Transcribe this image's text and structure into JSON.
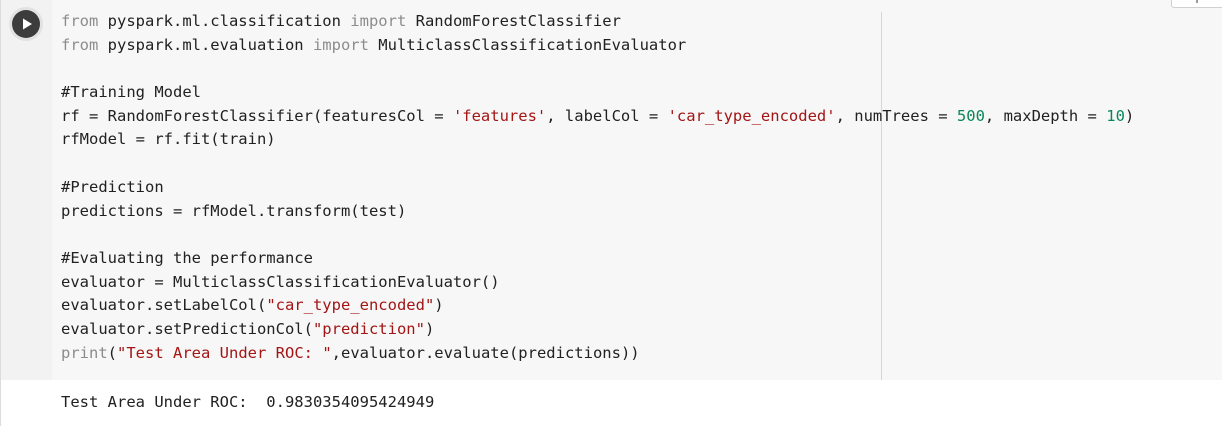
{
  "cell": {
    "run_button_icon": "play-icon",
    "code_lines": [
      [
        {
          "t": "from",
          "c": "kw"
        },
        {
          "t": " pyspark.ml.classification ",
          "c": ""
        },
        {
          "t": "import",
          "c": "kw"
        },
        {
          "t": " RandomForestClassifier",
          "c": ""
        }
      ],
      [
        {
          "t": "from",
          "c": "kw"
        },
        {
          "t": " pyspark.ml.evaluation ",
          "c": ""
        },
        {
          "t": "import",
          "c": "kw"
        },
        {
          "t": " MulticlassClassificationEvaluator",
          "c": ""
        }
      ],
      [],
      [
        {
          "t": "#Training Model",
          "c": ""
        }
      ],
      [
        {
          "t": "rf = RandomForestClassifier(featuresCol = ",
          "c": ""
        },
        {
          "t": "'features'",
          "c": "str"
        },
        {
          "t": ", labelCol = ",
          "c": ""
        },
        {
          "t": "'car_type_encoded'",
          "c": "str"
        },
        {
          "t": ", numTrees = ",
          "c": ""
        },
        {
          "t": "500",
          "c": "num"
        },
        {
          "t": ", maxDepth = ",
          "c": ""
        },
        {
          "t": "10",
          "c": "num"
        },
        {
          "t": ")",
          "c": ""
        }
      ],
      [
        {
          "t": "rfModel = rf.fit(train)",
          "c": ""
        }
      ],
      [],
      [
        {
          "t": "#Prediction",
          "c": ""
        }
      ],
      [
        {
          "t": "predictions = rfModel.transform(test)",
          "c": ""
        }
      ],
      [],
      [
        {
          "t": "#Evaluating the performance",
          "c": ""
        }
      ],
      [
        {
          "t": "evaluator = MulticlassClassificationEvaluator()",
          "c": ""
        }
      ],
      [
        {
          "t": "evaluator.setLabelCol(",
          "c": ""
        },
        {
          "t": "\"car_type_encoded\"",
          "c": "str"
        },
        {
          "t": ")",
          "c": ""
        }
      ],
      [
        {
          "t": "evaluator.setPredictionCol(",
          "c": ""
        },
        {
          "t": "\"prediction\"",
          "c": "str"
        },
        {
          "t": ")",
          "c": ""
        }
      ],
      [
        {
          "t": "print",
          "c": "kw"
        },
        {
          "t": "(",
          "c": ""
        },
        {
          "t": "\"Test Area Under ROC: \"",
          "c": "str"
        },
        {
          "t": ",evaluator.evaluate(predictions))",
          "c": ""
        }
      ]
    ],
    "output_text": "Test Area Under ROC:  0.9830354095424949"
  },
  "colors": {
    "keyword": "#8c8c8c",
    "string": "#a31515",
    "number": "#098658",
    "code_background": "#f7f7f7",
    "run_button": "#3c3c3c"
  }
}
